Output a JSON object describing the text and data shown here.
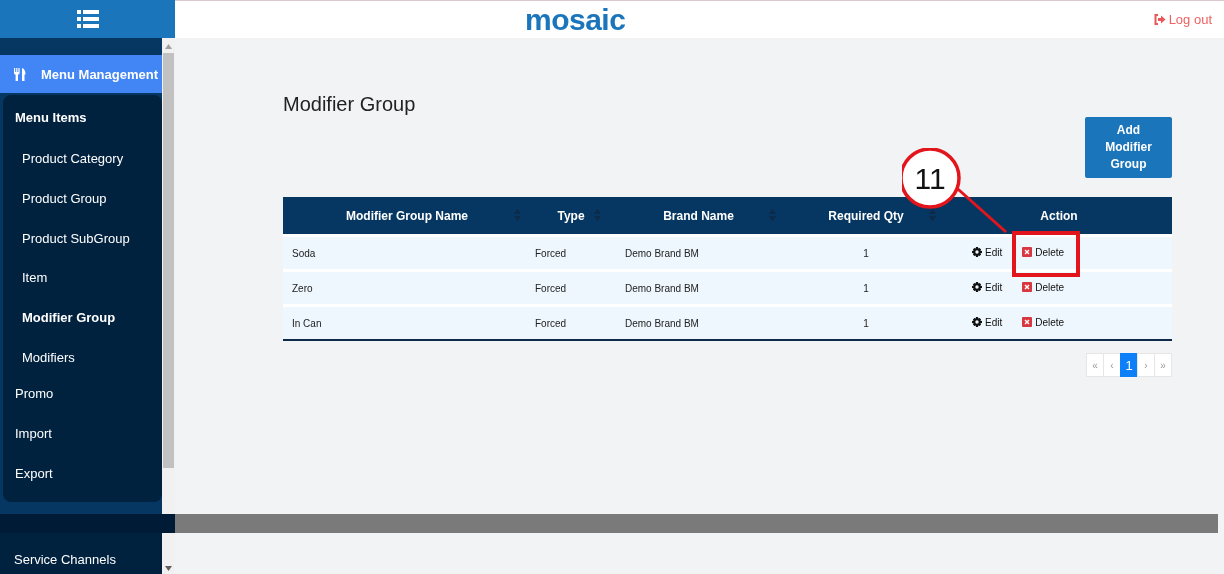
{
  "header": {
    "logo": "mosaic",
    "logout": "Log out"
  },
  "sidebar": {
    "items": [
      {
        "label": "Menu Management",
        "selected": true,
        "children": [
          {
            "label": "Menu Items",
            "expanded": true,
            "children": [
              {
                "label": "Product Category",
                "selected": false
              },
              {
                "label": "Product Group",
                "selected": false
              },
              {
                "label": "Product SubGroup",
                "selected": false
              },
              {
                "label": "Item",
                "selected": false
              },
              {
                "label": "Modifier Group",
                "selected": true
              },
              {
                "label": "Modifiers",
                "selected": false
              }
            ]
          },
          {
            "label": "Promo",
            "expanded": false
          },
          {
            "label": "Import",
            "expanded": false
          },
          {
            "label": "Export",
            "expanded": false
          }
        ]
      },
      {
        "label": "Service Channels",
        "selected": false
      }
    ]
  },
  "page": {
    "title": "Modifier Group",
    "add_button": "Add Modifier Group"
  },
  "table": {
    "columns": [
      {
        "label": "Modifier Group Name",
        "sortable": true
      },
      {
        "label": "Type",
        "sortable": true
      },
      {
        "label": "Brand Name",
        "sortable": true
      },
      {
        "label": "Required Qty",
        "sortable": true
      },
      {
        "label": "Action",
        "sortable": false
      }
    ],
    "rows": [
      {
        "name": "Soda",
        "type": "Forced",
        "brand": "Demo Brand BM",
        "required_qty": "1",
        "edit": "Edit",
        "delete": "Delete"
      },
      {
        "name": "Zero",
        "type": "Forced",
        "brand": "Demo Brand BM",
        "required_qty": "1",
        "edit": "Edit",
        "delete": "Delete"
      },
      {
        "name": "In Can",
        "type": "Forced",
        "brand": "Demo Brand BM",
        "required_qty": "1",
        "edit": "Edit",
        "delete": "Delete"
      }
    ]
  },
  "pagination": [
    {
      "label": "«",
      "selected": false
    },
    {
      "label": "‹",
      "selected": false
    },
    {
      "label": "1",
      "selected": true
    },
    {
      "label": "›",
      "selected": false
    },
    {
      "label": "»",
      "selected": false
    }
  ],
  "annotation": {
    "callout": "11"
  }
}
